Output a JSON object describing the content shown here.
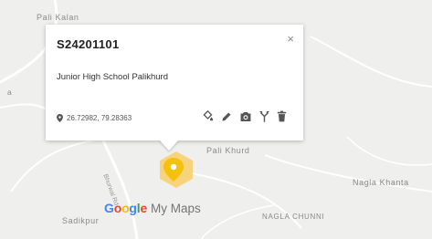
{
  "map": {
    "places": {
      "pali_kalan": "Pali Kalan",
      "pali_khurd": "Pali Khurd",
      "nagla_khanta": "Nagla Khanta",
      "nagla_chunni": "NAGLA CHUNNI",
      "sadikpur": "Sadikpur",
      "left_edge": "a"
    },
    "road_label": "Bhurwal Rd"
  },
  "popup": {
    "title": "S24201101",
    "close_label": "×",
    "description": "Junior High School Palikhurd",
    "coordinates": "26.72982, 79.28363",
    "actions": [
      "style-icon",
      "edit-icon",
      "camera-icon",
      "directions-icon",
      "delete-icon"
    ]
  },
  "marker": {
    "color": "#f4c20d",
    "halo_color": "#f8ce6a"
  },
  "brand": {
    "google_letters": [
      "G",
      "o",
      "o",
      "g",
      "l",
      "e"
    ],
    "google_colors": [
      "#4285f4",
      "#ea4335",
      "#fbbc05",
      "#4285f4",
      "#34a853",
      "#ea4335"
    ],
    "product": "My Maps"
  }
}
